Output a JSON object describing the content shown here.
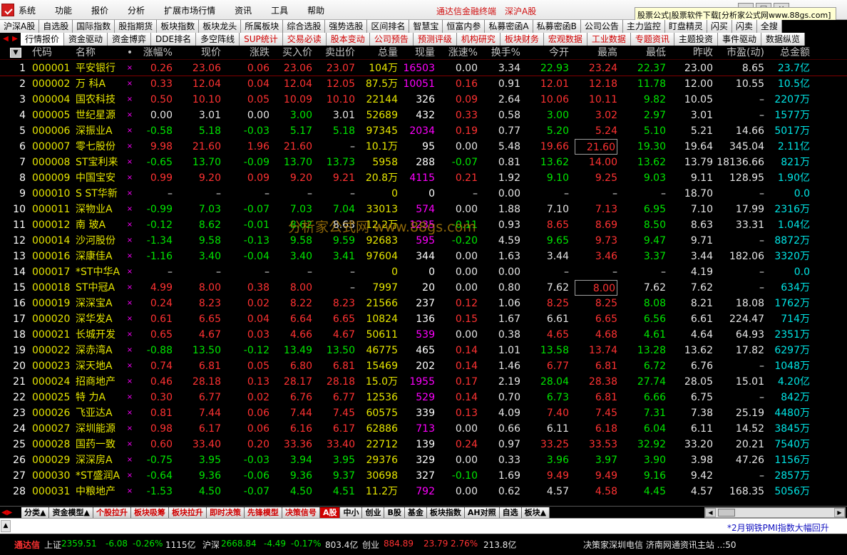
{
  "menu": [
    "系统",
    "功能",
    "报价",
    "分析",
    "扩展市场行情",
    "资讯",
    "工具",
    "帮助"
  ],
  "title_brand": "通达信金融终端",
  "title_market": "深沪A股",
  "title_right": "股票公式|股票软件下载[分析家公式网www.88gs.com]",
  "tabs_row1": [
    "沪深A股",
    "自选股",
    "国际指数",
    "股指期货",
    "板块指数",
    "板块龙头",
    "所属板块",
    "综合选股",
    "强势选股",
    "区间排名",
    "智慧宝",
    "恒富内参",
    "私募密函A",
    "私募密函B",
    "公司公告",
    "主力监控",
    "盯盘精灵",
    "闪买",
    "闪卖",
    "全搜"
  ],
  "tabs_row2": [
    {
      "label": "行情报价",
      "color": "#000000"
    },
    {
      "label": "资金驱动",
      "color": "#000000"
    },
    {
      "label": "资金博弈",
      "color": "#000000"
    },
    {
      "label": "DDE排名",
      "color": "#000000"
    },
    {
      "label": "多空阵线",
      "color": "#000000"
    },
    {
      "label": "SUP统计",
      "color": "#d00000"
    },
    {
      "label": "交易必读",
      "color": "#d00000"
    },
    {
      "label": "股本变动",
      "color": "#d00000"
    },
    {
      "label": "公司预告",
      "color": "#d00000"
    },
    {
      "label": "预测评级",
      "color": "#d00000"
    },
    {
      "label": "机构研究",
      "color": "#d00000"
    },
    {
      "label": "板块财务",
      "color": "#d00000"
    },
    {
      "label": "宏观数据",
      "color": "#d00000"
    },
    {
      "label": "工业数据",
      "color": "#d00000"
    },
    {
      "label": "专题资讯",
      "color": "#d00000"
    },
    {
      "label": "主题投资",
      "color": "#000000"
    },
    {
      "label": "事件驱动",
      "color": "#000000"
    },
    {
      "label": "数据纵览",
      "color": "#000000"
    }
  ],
  "columns": [
    "代码",
    "名称",
    "•",
    "涨幅%",
    "现价",
    "涨跌",
    "买入价",
    "卖出价",
    "总量",
    "现量",
    "涨速%",
    "换手%",
    "今开",
    "最高",
    "最低",
    "昨收",
    "市盈(动)",
    "总金额"
  ],
  "colors": {
    "up": "#ff3232",
    "down": "#00e600",
    "neutral": "#e6e6e6",
    "code": "#e6e600",
    "name": "#e6e600",
    "amount": "#00e6e6",
    "volume": "#e6e600",
    "mag": "#ff00ff",
    "white": "#ffffff"
  },
  "rows": [
    {
      "n": "1",
      "code": "000001",
      "name": "平安银行",
      "pct": "0.26",
      "price": "23.06",
      "chg": "0.06",
      "bid": "23.06",
      "ask": "23.07",
      "vol": "104万",
      "cur": "16503",
      "spd": "0.00",
      "turn": "3.34",
      "open": "22.93",
      "high": "23.24",
      "low": "22.37",
      "prev": "23.00",
      "pe": "8.65",
      "amt": "23.7亿"
    },
    {
      "n": "2",
      "code": "000002",
      "name": "万  科A",
      "pct": "0.33",
      "price": "12.04",
      "chg": "0.04",
      "bid": "12.04",
      "ask": "12.05",
      "vol": "87.5万",
      "cur": "10051",
      "spd": "0.16",
      "turn": "0.91",
      "open": "12.01",
      "high": "12.18",
      "low": "11.78",
      "prev": "12.00",
      "pe": "10.55",
      "amt": "10.5亿"
    },
    {
      "n": "3",
      "code": "000004",
      "name": "国农科技",
      "pct": "0.50",
      "price": "10.10",
      "chg": "0.05",
      "bid": "10.09",
      "ask": "10.10",
      "vol": "22144",
      "cur": "326",
      "spd": "0.09",
      "turn": "2.64",
      "open": "10.06",
      "high": "10.11",
      "low": "9.82",
      "prev": "10.05",
      "pe": "–",
      "amt": "2207万"
    },
    {
      "n": "4",
      "code": "000005",
      "name": "世纪星源",
      "pct": "0.00",
      "price": "3.01",
      "chg": "0.00",
      "bid": "3.00",
      "ask": "3.01",
      "vol": "52689",
      "cur": "432",
      "spd": "0.33",
      "turn": "0.58",
      "open": "3.00",
      "high": "3.02",
      "low": "2.97",
      "prev": "3.01",
      "pe": "–",
      "amt": "1577万"
    },
    {
      "n": "5",
      "code": "000006",
      "name": "深振业A",
      "pct": "-0.58",
      "price": "5.18",
      "chg": "-0.03",
      "bid": "5.17",
      "ask": "5.18",
      "vol": "97345",
      "cur": "2034",
      "spd": "0.19",
      "turn": "0.77",
      "open": "5.20",
      "high": "5.24",
      "low": "5.10",
      "prev": "5.21",
      "pe": "14.66",
      "amt": "5017万"
    },
    {
      "n": "6",
      "code": "000007",
      "name": "零七股份",
      "pct": "9.98",
      "price": "21.60",
      "chg": "1.96",
      "bid": "21.60",
      "ask": "–",
      "vol": "10.1万",
      "cur": "95",
      "spd": "0.00",
      "turn": "5.48",
      "open": "19.66",
      "high": "21.60",
      "low": "19.30",
      "prev": "19.64",
      "pe": "345.04",
      "amt": "2.11亿"
    },
    {
      "n": "7",
      "code": "000008",
      "name": "ST宝利来",
      "pct": "-0.65",
      "price": "13.70",
      "chg": "-0.09",
      "bid": "13.70",
      "ask": "13.73",
      "vol": "5958",
      "cur": "288",
      "spd": "-0.07",
      "turn": "0.81",
      "open": "13.62",
      "high": "14.00",
      "low": "13.62",
      "prev": "13.79",
      "pe": "18136.66",
      "amt": "821万"
    },
    {
      "n": "8",
      "code": "000009",
      "name": "中国宝安",
      "pct": "0.99",
      "price": "9.20",
      "chg": "0.09",
      "bid": "9.20",
      "ask": "9.21",
      "vol": "20.8万",
      "cur": "4115",
      "spd": "0.21",
      "turn": "1.92",
      "open": "9.10",
      "high": "9.25",
      "low": "9.03",
      "prev": "9.11",
      "pe": "128.95",
      "amt": "1.90亿"
    },
    {
      "n": "9",
      "code": "000010",
      "name": "S ST华新",
      "pct": "–",
      "price": "–",
      "chg": "–",
      "bid": "–",
      "ask": "–",
      "vol": "0",
      "cur": "0",
      "spd": "–",
      "turn": "0.00",
      "open": "–",
      "high": "–",
      "low": "–",
      "prev": "18.70",
      "pe": "–",
      "amt": "0.0"
    },
    {
      "n": "10",
      "code": "000011",
      "name": "深物业A",
      "pct": "-0.99",
      "price": "7.03",
      "chg": "-0.07",
      "bid": "7.03",
      "ask": "7.04",
      "vol": "33013",
      "cur": "574",
      "spd": "0.00",
      "turn": "1.88",
      "open": "7.10",
      "high": "7.13",
      "low": "6.95",
      "prev": "7.10",
      "pe": "17.99",
      "amt": "2316万"
    },
    {
      "n": "11",
      "code": "000012",
      "name": "南  玻A",
      "pct": "-0.12",
      "price": "8.62",
      "chg": "-0.01",
      "bid": "8.62",
      "ask": "8.63",
      "vol": "12.2万",
      "cur": "1235",
      "spd": "-0.11",
      "turn": "0.93",
      "open": "8.65",
      "high": "8.69",
      "low": "8.50",
      "prev": "8.63",
      "pe": "33.31",
      "amt": "1.04亿"
    },
    {
      "n": "12",
      "code": "000014",
      "name": "沙河股份",
      "pct": "-1.34",
      "price": "9.58",
      "chg": "-0.13",
      "bid": "9.58",
      "ask": "9.59",
      "vol": "92683",
      "cur": "595",
      "spd": "-0.20",
      "turn": "4.59",
      "open": "9.65",
      "high": "9.73",
      "low": "9.47",
      "prev": "9.71",
      "pe": "–",
      "amt": "8872万"
    },
    {
      "n": "13",
      "code": "000016",
      "name": "深康佳A",
      "pct": "-1.16",
      "price": "3.40",
      "chg": "-0.04",
      "bid": "3.40",
      "ask": "3.41",
      "vol": "97604",
      "cur": "344",
      "spd": "0.00",
      "turn": "1.63",
      "open": "3.44",
      "high": "3.46",
      "low": "3.37",
      "prev": "3.44",
      "pe": "182.06",
      "amt": "3320万"
    },
    {
      "n": "14",
      "code": "000017",
      "name": "*ST中华A",
      "pct": "–",
      "price": "–",
      "chg": "–",
      "bid": "–",
      "ask": "–",
      "vol": "0",
      "cur": "0",
      "spd": "0.00",
      "turn": "0.00",
      "open": "–",
      "high": "–",
      "low": "–",
      "prev": "4.19",
      "pe": "–",
      "amt": "0.0"
    },
    {
      "n": "15",
      "code": "000018",
      "name": "ST中冠A",
      "pct": "4.99",
      "price": "8.00",
      "chg": "0.38",
      "bid": "8.00",
      "ask": "–",
      "vol": "7997",
      "cur": "20",
      "spd": "0.00",
      "turn": "0.80",
      "open": "7.62",
      "high": "8.00",
      "low": "7.62",
      "prev": "7.62",
      "pe": "–",
      "amt": "634万"
    },
    {
      "n": "16",
      "code": "000019",
      "name": "深深宝A",
      "pct": "0.24",
      "price": "8.23",
      "chg": "0.02",
      "bid": "8.22",
      "ask": "8.23",
      "vol": "21566",
      "cur": "237",
      "spd": "0.12",
      "turn": "1.06",
      "open": "8.25",
      "high": "8.25",
      "low": "8.08",
      "prev": "8.21",
      "pe": "18.08",
      "amt": "1762万"
    },
    {
      "n": "17",
      "code": "000020",
      "name": "深华发A",
      "pct": "0.61",
      "price": "6.65",
      "chg": "0.04",
      "bid": "6.64",
      "ask": "6.65",
      "vol": "10824",
      "cur": "136",
      "spd": "0.15",
      "turn": "1.67",
      "open": "6.61",
      "high": "6.65",
      "low": "6.56",
      "prev": "6.61",
      "pe": "224.47",
      "amt": "714万"
    },
    {
      "n": "18",
      "code": "000021",
      "name": "长城开发",
      "pct": "0.65",
      "price": "4.67",
      "chg": "0.03",
      "bid": "4.66",
      "ask": "4.67",
      "vol": "50611",
      "cur": "539",
      "spd": "0.00",
      "turn": "0.38",
      "open": "4.65",
      "high": "4.68",
      "low": "4.61",
      "prev": "4.64",
      "pe": "64.93",
      "amt": "2351万"
    },
    {
      "n": "19",
      "code": "000022",
      "name": "深赤湾A",
      "pct": "-0.88",
      "price": "13.50",
      "chg": "-0.12",
      "bid": "13.49",
      "ask": "13.50",
      "vol": "46775",
      "cur": "465",
      "spd": "0.14",
      "turn": "1.01",
      "open": "13.58",
      "high": "13.74",
      "low": "13.28",
      "prev": "13.62",
      "pe": "17.82",
      "amt": "6297万"
    },
    {
      "n": "20",
      "code": "000023",
      "name": "深天地A",
      "pct": "0.74",
      "price": "6.81",
      "chg": "0.05",
      "bid": "6.80",
      "ask": "6.81",
      "vol": "15469",
      "cur": "202",
      "spd": "0.14",
      "turn": "1.46",
      "open": "6.77",
      "high": "6.81",
      "low": "6.72",
      "prev": "6.76",
      "pe": "–",
      "amt": "1048万"
    },
    {
      "n": "21",
      "code": "000024",
      "name": "招商地产",
      "pct": "0.46",
      "price": "28.18",
      "chg": "0.13",
      "bid": "28.17",
      "ask": "28.18",
      "vol": "15.0万",
      "cur": "1955",
      "spd": "0.17",
      "turn": "2.19",
      "open": "28.04",
      "high": "28.38",
      "low": "27.74",
      "prev": "28.05",
      "pe": "15.01",
      "amt": "4.20亿"
    },
    {
      "n": "22",
      "code": "000025",
      "name": "特  力A",
      "pct": "0.30",
      "price": "6.77",
      "chg": "0.02",
      "bid": "6.76",
      "ask": "6.77",
      "vol": "12536",
      "cur": "529",
      "spd": "0.14",
      "turn": "0.70",
      "open": "6.73",
      "high": "6.81",
      "low": "6.66",
      "prev": "6.75",
      "pe": "–",
      "amt": "842万"
    },
    {
      "n": "23",
      "code": "000026",
      "name": "飞亚达A",
      "pct": "0.81",
      "price": "7.44",
      "chg": "0.06",
      "bid": "7.44",
      "ask": "7.45",
      "vol": "60575",
      "cur": "339",
      "spd": "0.13",
      "turn": "4.09",
      "open": "7.40",
      "high": "7.45",
      "low": "7.31",
      "prev": "7.38",
      "pe": "25.19",
      "amt": "4480万"
    },
    {
      "n": "24",
      "code": "000027",
      "name": "深圳能源",
      "pct": "0.98",
      "price": "6.17",
      "chg": "0.06",
      "bid": "6.16",
      "ask": "6.17",
      "vol": "62886",
      "cur": "713",
      "spd": "0.00",
      "turn": "0.66",
      "open": "6.11",
      "high": "6.18",
      "low": "6.04",
      "prev": "6.11",
      "pe": "14.52",
      "amt": "3845万"
    },
    {
      "n": "25",
      "code": "000028",
      "name": "国药一致",
      "pct": "0.60",
      "price": "33.40",
      "chg": "0.20",
      "bid": "33.36",
      "ask": "33.40",
      "vol": "22712",
      "cur": "139",
      "spd": "0.24",
      "turn": "0.97",
      "open": "33.25",
      "high": "33.53",
      "low": "32.92",
      "prev": "33.20",
      "pe": "20.21",
      "amt": "7540万"
    },
    {
      "n": "26",
      "code": "000029",
      "name": "深深房A",
      "pct": "-0.75",
      "price": "3.95",
      "chg": "-0.03",
      "bid": "3.94",
      "ask": "3.95",
      "vol": "29376",
      "cur": "329",
      "spd": "0.00",
      "turn": "0.33",
      "open": "3.96",
      "high": "3.97",
      "low": "3.90",
      "prev": "3.98",
      "pe": "47.26",
      "amt": "1156万"
    },
    {
      "n": "27",
      "code": "000030",
      "name": "*ST盛润A",
      "pct": "-0.64",
      "price": "9.36",
      "chg": "-0.06",
      "bid": "9.36",
      "ask": "9.37",
      "vol": "30698",
      "cur": "327",
      "spd": "-0.10",
      "turn": "1.69",
      "open": "9.49",
      "high": "9.49",
      "low": "9.16",
      "prev": "9.42",
      "pe": "–",
      "amt": "2857万"
    },
    {
      "n": "28",
      "code": "000031",
      "name": "中粮地产",
      "pct": "-1.53",
      "price": "4.50",
      "chg": "-0.07",
      "bid": "4.50",
      "ask": "4.51",
      "vol": "11.2万",
      "cur": "792",
      "spd": "0.00",
      "turn": "0.62",
      "open": "4.57",
      "high": "4.58",
      "low": "4.45",
      "prev": "4.57",
      "pe": "168.35",
      "amt": "5056万"
    }
  ],
  "bottom_tabs": [
    {
      "label": "分类▲",
      "color": "#000000"
    },
    {
      "label": "资金模型▲",
      "color": "#000000"
    },
    {
      "label": "个股拉升",
      "color": "#d00000"
    },
    {
      "label": "板块吸筹",
      "color": "#d00000"
    },
    {
      "label": "板块拉升",
      "color": "#d00000"
    },
    {
      "label": "即时决策",
      "color": "#d00000"
    },
    {
      "label": "先锋模型",
      "color": "#d00000"
    },
    {
      "label": "决策信号",
      "color": "#d00000"
    },
    {
      "label": "A股",
      "color": "#ffffff",
      "active": true
    },
    {
      "label": "中小",
      "color": "#000000"
    },
    {
      "label": "创业",
      "color": "#000000"
    },
    {
      "label": "B股",
      "color": "#000000"
    },
    {
      "label": "基金",
      "color": "#000000"
    },
    {
      "label": "板块指数",
      "color": "#000000"
    },
    {
      "label": "AH对照",
      "color": "#000000"
    },
    {
      "label": "自选",
      "color": "#000000"
    },
    {
      "label": "板块▲",
      "color": "#000000"
    }
  ],
  "news": "*2月钢铁PMI指数大幅回升",
  "status": {
    "brand": "通达信",
    "sh_label": "上证",
    "sh_val": "2359.51",
    "sh_chg": "-6.08",
    "sh_pct": "-0.26%",
    "sh_amt": "1115亿",
    "sz_label": "沪深",
    "sz_val": "2668.84",
    "sz_chg": "-4.49",
    "sz_pct": "-0.17%",
    "sz_amt": "803.4亿",
    "cy_label": "创业",
    "cy_val": "884.89",
    "cy_chg": "23.79",
    "cy_pct": "2.76%",
    "cy_amt": "213.8亿",
    "right": "决策家深圳电信 济南网通资讯主站 ..:50"
  },
  "watermark": "分析家公式网 www.88gs.com"
}
